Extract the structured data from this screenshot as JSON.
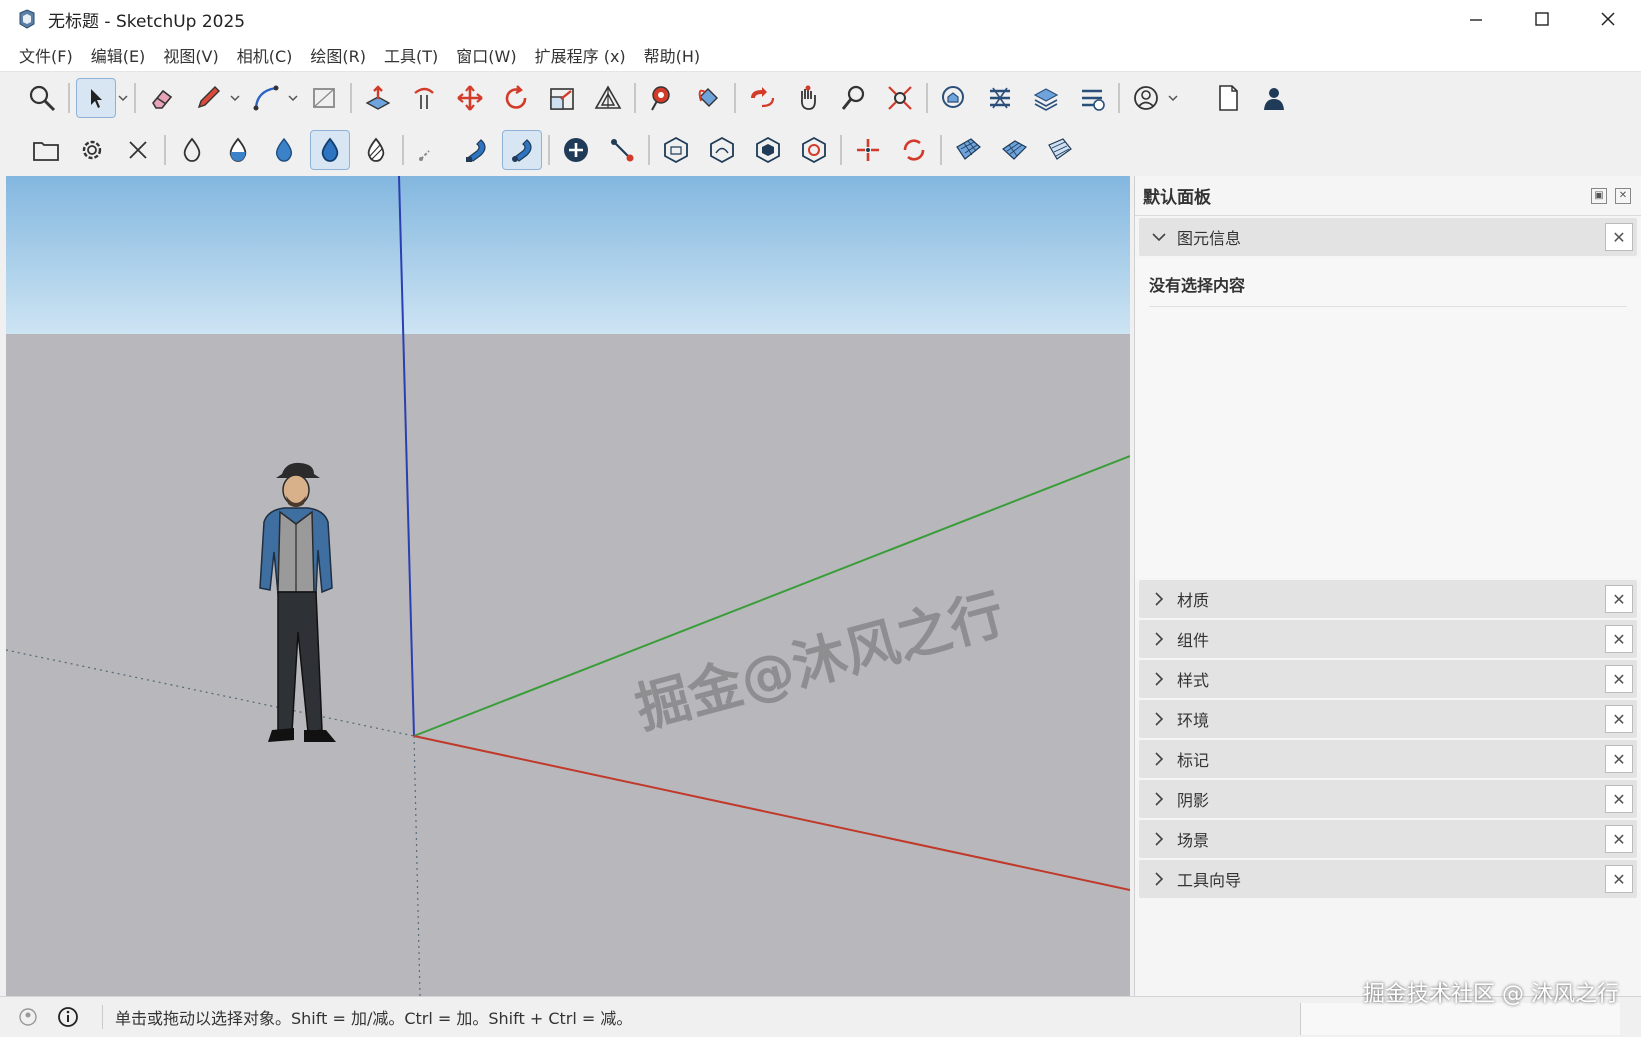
{
  "window": {
    "title": "无标题 - SketchUp 2025"
  },
  "menu": [
    "文件(F)",
    "编辑(E)",
    "视图(V)",
    "相机(C)",
    "绘图(R)",
    "工具(T)",
    "窗口(W)",
    "扩展程序 (x)",
    "帮助(H)"
  ],
  "viewport": {
    "watermark": "掘金@沐风之行"
  },
  "panel": {
    "title": "默认面板",
    "entity_info": {
      "label": "图元信息",
      "body": "没有选择内容"
    },
    "trays": [
      "材质",
      "组件",
      "样式",
      "环境",
      "标记",
      "阴影",
      "场景",
      "工具向导"
    ]
  },
  "status": {
    "text": "单击或拖动以选择对象。Shift = 加/减。Ctrl = 加。Shift + Ctrl = 减。"
  },
  "corner_watermark": "掘金技术社区 @ 沐风之行",
  "colors": {
    "axis_red": "#c0392b",
    "axis_green": "#3a9d3a",
    "axis_blue": "#2a3fb0",
    "sky_top": "#83b7df",
    "ground": "#b8b8bc"
  }
}
